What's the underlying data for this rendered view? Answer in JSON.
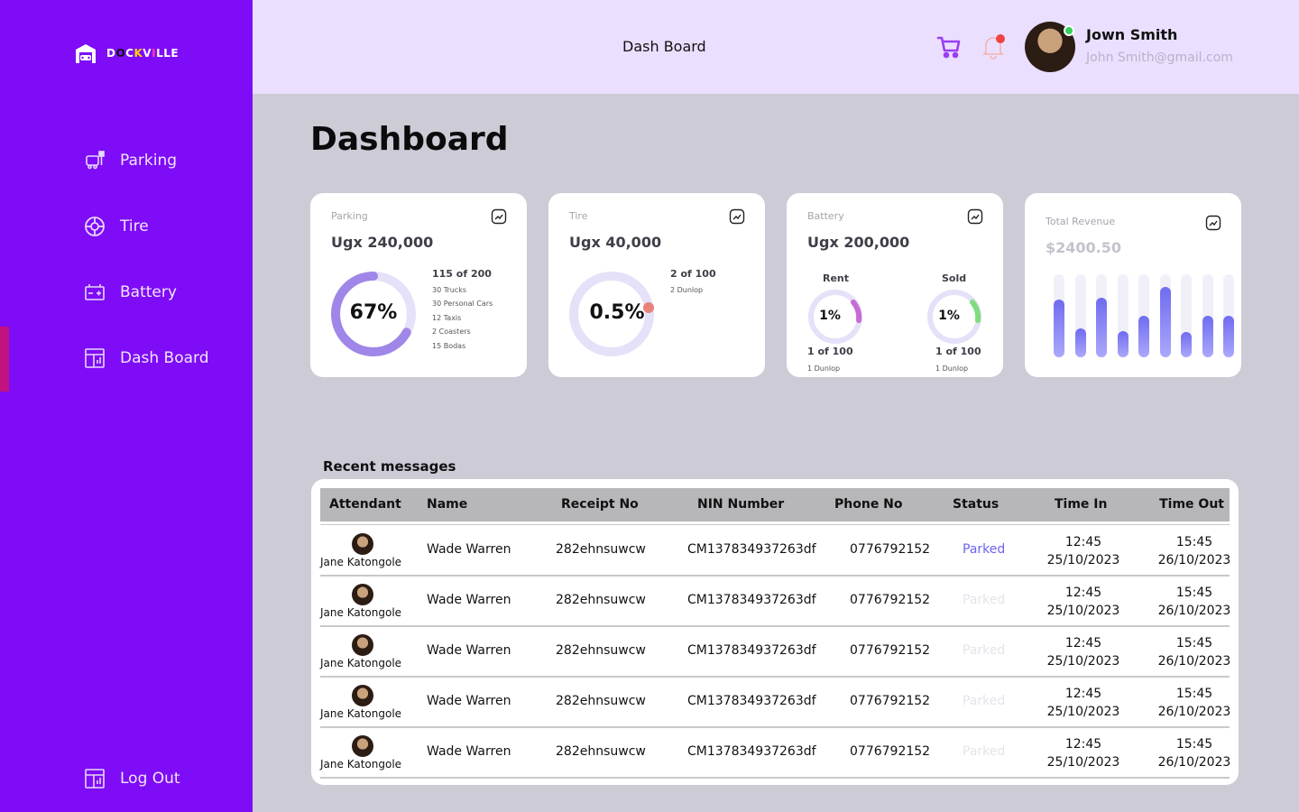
{
  "brand": {
    "name_parts": [
      "D",
      "O",
      "C",
      "K",
      "V",
      "I",
      "LLE"
    ]
  },
  "sidebar": {
    "items": [
      {
        "label": "Parking",
        "icon": "parking-icon"
      },
      {
        "label": "Tire",
        "icon": "tire-icon"
      },
      {
        "label": "Battery",
        "icon": "battery-icon"
      },
      {
        "label": "Dash Board",
        "icon": "dashboard-icon",
        "active": true
      }
    ],
    "logout": {
      "label": "Log Out",
      "icon": "logout-icon"
    }
  },
  "header": {
    "title": "Dash Board",
    "user": {
      "name": "Jown Smith",
      "email": "John Smith@gmail.com"
    }
  },
  "page": {
    "title": "Dashboard"
  },
  "cards": {
    "parking": {
      "title": "Parking",
      "value": "Ugx 240,000",
      "percent_label": "67%",
      "percent": 67,
      "summary": "115 of 200",
      "lines": [
        "30 Trucks",
        "30 Personal Cars",
        "12 Taxis",
        "2 Coasters",
        "15 Bodas"
      ]
    },
    "tire": {
      "title": "Tire",
      "value": "Ugx 40,000",
      "percent_label": "0.5%",
      "percent": 0.5,
      "summary": "2 of 100",
      "lines": [
        "2 Dunlop"
      ]
    },
    "battery": {
      "title": "Battery",
      "value": "Ugx 200,000",
      "rent": {
        "label": "Rent",
        "percent_label": "1%",
        "percent": 1,
        "count": "1 of 100",
        "detail": "1 Dunlop"
      },
      "sold": {
        "label": "Sold",
        "percent_label": "1%",
        "percent": 1,
        "count": "1 of 100",
        "detail": "1 Dunlop"
      }
    },
    "revenue": {
      "title": "Total Revenue",
      "value": "$2400.50",
      "bars": [
        0.7,
        0.35,
        0.72,
        0.32,
        0.5,
        0.85,
        0.3,
        0.5,
        0.5
      ]
    }
  },
  "colors": {
    "sidebar": "#7f0cf6",
    "accent": "#6b63f2",
    "parking_ring": "#9f86e8",
    "tire_dot": "#e8837a",
    "rent_ring": "#c86ad6",
    "sold_ring": "#7fdc7f"
  },
  "messages": {
    "title": "Recent messages",
    "columns": [
      "Attendant",
      "Name",
      "Receipt No",
      "NIN Number",
      "Phone No",
      "Status",
      "Time In",
      "Time Out"
    ],
    "rows": [
      {
        "attendant": "Jane Katongole",
        "name": "Wade Warren",
        "receipt": "282ehnsuwcw",
        "nin": "CM137834937263df",
        "phone": "0776792152",
        "status": "Parked",
        "status_style": "active",
        "time_in": "12:45",
        "date_in": "25/10/2023",
        "time_out": "15:45",
        "date_out": "26/10/2023"
      },
      {
        "attendant": "Jane Katongole",
        "name": "Wade Warren",
        "receipt": "282ehnsuwcw",
        "nin": "CM137834937263df",
        "phone": "0776792152",
        "status": "Parked",
        "status_style": "faded",
        "time_in": "12:45",
        "date_in": "25/10/2023",
        "time_out": "15:45",
        "date_out": "26/10/2023"
      },
      {
        "attendant": "Jane Katongole",
        "name": "Wade Warren",
        "receipt": "282ehnsuwcw",
        "nin": "CM137834937263df",
        "phone": "0776792152",
        "status": "Parked",
        "status_style": "faded",
        "time_in": "12:45",
        "date_in": "25/10/2023",
        "time_out": "15:45",
        "date_out": "26/10/2023"
      },
      {
        "attendant": "Jane Katongole",
        "name": "Wade Warren",
        "receipt": "282ehnsuwcw",
        "nin": "CM137834937263df",
        "phone": "0776792152",
        "status": "Parked",
        "status_style": "faded",
        "time_in": "12:45",
        "date_in": "25/10/2023",
        "time_out": "15:45",
        "date_out": "26/10/2023"
      },
      {
        "attendant": "Jane Katongole",
        "name": "Wade Warren",
        "receipt": "282ehnsuwcw",
        "nin": "CM137834937263df",
        "phone": "0776792152",
        "status": "Parked",
        "status_style": "faded",
        "time_in": "12:45",
        "date_in": "25/10/2023",
        "time_out": "15:45",
        "date_out": "26/10/2023"
      }
    ]
  }
}
